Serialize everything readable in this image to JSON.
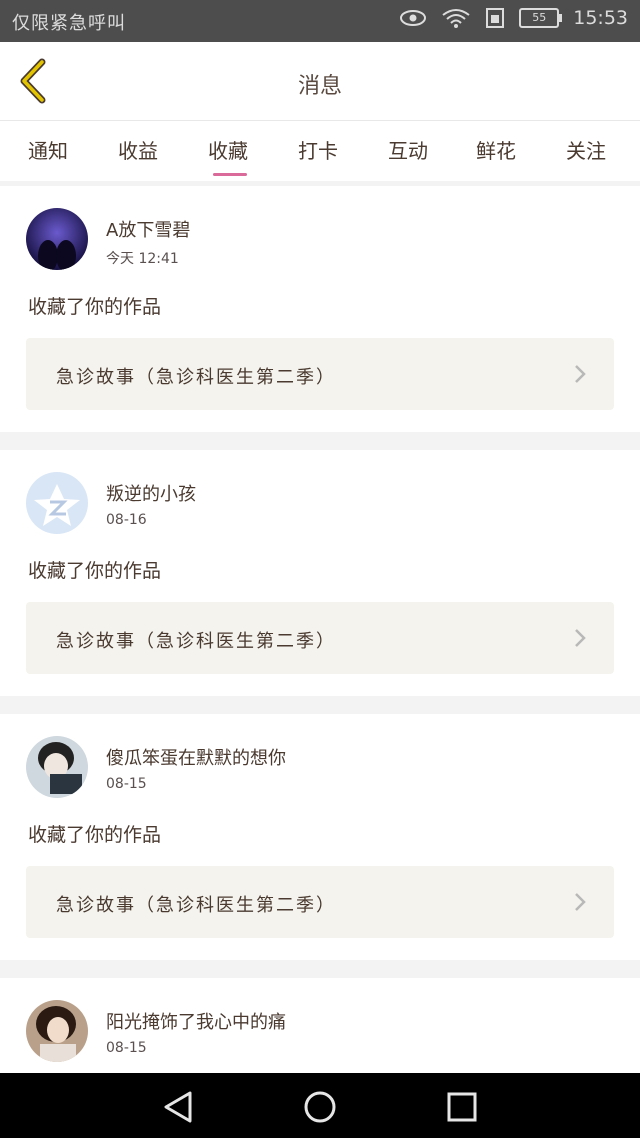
{
  "status_bar": {
    "carrier": "仅限紧急呼叫",
    "battery": "55",
    "time": "15:53"
  },
  "header": {
    "title": "消息"
  },
  "tabs": [
    "通知",
    "收益",
    "收藏",
    "打卡",
    "互动",
    "鲜花",
    "关注"
  ],
  "active_tab": "收藏",
  "messages": [
    {
      "name": "A放下雪碧",
      "time": "今天 12:41",
      "action": "收藏了你的作品",
      "work": "急诊故事（急诊科医生第二季）"
    },
    {
      "name": "叛逆的小孩",
      "time": "08-16",
      "action": "收藏了你的作品",
      "work": "急诊故事（急诊科医生第二季）"
    },
    {
      "name": "傻瓜笨蛋在默默的想你",
      "time": "08-15",
      "action": "收藏了你的作品",
      "work": "急诊故事（急诊科医生第二季）"
    },
    {
      "name": "阳光掩饰了我心中的痛",
      "time": "08-15"
    }
  ],
  "icons": {
    "back": "chevron-left-icon",
    "work_arrow": "chevron-right-icon",
    "nav": [
      "back-triangle-icon",
      "home-circle-icon",
      "recents-square-icon"
    ]
  },
  "colors": {
    "tab_indicator": "#d96a9a",
    "back_icon": "#e2c400"
  }
}
